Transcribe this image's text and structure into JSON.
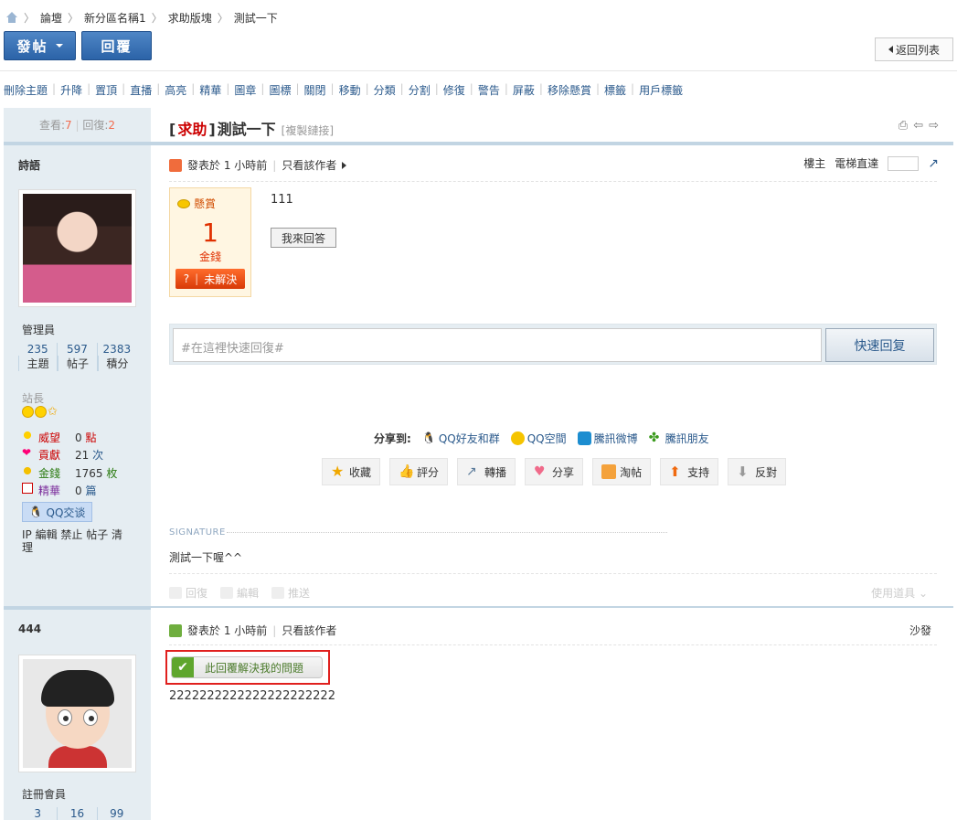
{
  "breadcrumb": [
    "論壇",
    "新分區名稱1",
    "求助版塊",
    "測試一下"
  ],
  "toolbar": {
    "post_label": "發帖",
    "reply_label": "回覆",
    "back_label": "返回列表"
  },
  "mod_actions": [
    "刪除主題",
    "升降",
    "置頂",
    "直播",
    "高亮",
    "精華",
    "圖章",
    "圖標",
    "關閉",
    "移動",
    "分類",
    "分割",
    "修復",
    "警告",
    "屏蔽",
    "移除懸賞",
    "標籤",
    "用戶標籤"
  ],
  "thread": {
    "views_label": "查看:",
    "views": "7",
    "replies_label": "回復:",
    "replies": "2",
    "tag": "求助",
    "title": "測試一下",
    "copy_link": "[複製鏈接]"
  },
  "post1": {
    "author": "詩語",
    "role": "管理員",
    "stats": [
      {
        "value": "235",
        "label": "主題"
      },
      {
        "value": "597",
        "label": "帖子"
      },
      {
        "value": "2383",
        "label": "積分"
      }
    ],
    "rank": "站長",
    "credits": [
      {
        "icon": "prestige-icon",
        "label": "威望",
        "value": "0",
        "unit": "點"
      },
      {
        "icon": "heart-icon",
        "label": "貢獻",
        "value": "21",
        "unit": "次"
      },
      {
        "icon": "coin-icon",
        "label": "金錢",
        "value": "1765",
        "unit": "枚"
      },
      {
        "icon": "digest-icon",
        "label": "精華",
        "value": "0",
        "unit": "篇"
      }
    ],
    "qq_label": "QQ交谈",
    "admin_links": "IP 編輯 禁止 帖子 清理",
    "posted": "發表於 1 小時前",
    "only_author": "只看該作者",
    "floor_label": "樓主",
    "goto_label": "電梯直達",
    "reward": {
      "header": "懸賞",
      "amount": "1",
      "unit": "金錢",
      "status": "未解決"
    },
    "content": "111",
    "answer_button": "我來回答",
    "quick_reply_placeholder": "#在這裡快速回復#",
    "quick_reply_button": "快速回复",
    "share_label": "分享到:",
    "share_targets": [
      "QQ好友和群",
      "QQ空間",
      "騰訊微博",
      "騰訊朋友"
    ],
    "actions": [
      "收藏",
      "評分",
      "轉播",
      "分享",
      "淘帖",
      "支持",
      "反對"
    ],
    "signature_label": "SIGNATURE",
    "signature": "測試一下喔^^",
    "tools": [
      "回復",
      "編輯",
      "推送"
    ],
    "props_label": "使用道具"
  },
  "post2": {
    "author": "444",
    "role": "註冊會員",
    "stats": [
      "3",
      "16",
      "99"
    ],
    "posted": "發表於 1 小時前",
    "only_author": "只看該作者",
    "floor_label": "沙發",
    "solve_button": "此回覆解決我的問題",
    "content": "2222222222222222222222"
  },
  "colors": {
    "link": "#2b5a8c",
    "accent": "#cc0000",
    "sidebar": "#e5edf2",
    "highlight_box": "#e0201e"
  }
}
